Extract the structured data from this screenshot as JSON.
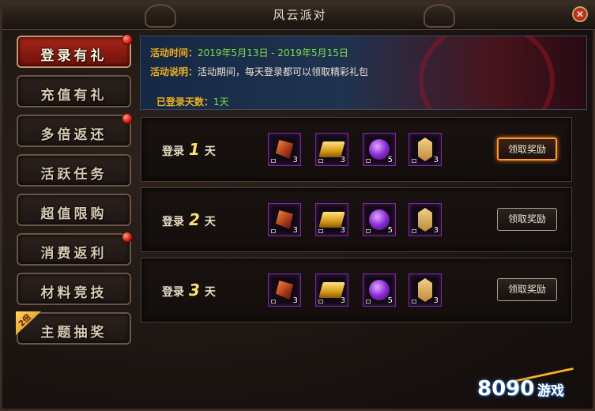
{
  "window": {
    "title": "风云派对"
  },
  "sidebar": {
    "items": [
      {
        "label": "登录有礼",
        "active": true,
        "has_dot": true
      },
      {
        "label": "充值有礼",
        "active": false,
        "has_dot": false
      },
      {
        "label": "多倍返还",
        "active": false,
        "has_dot": true
      },
      {
        "label": "活跃任务",
        "active": false,
        "has_dot": false
      },
      {
        "label": "超值限购",
        "active": false,
        "has_dot": false
      },
      {
        "label": "消费返利",
        "active": false,
        "has_dot": true
      },
      {
        "label": "材料竞技",
        "active": false,
        "has_dot": false
      },
      {
        "label": "主题抽奖",
        "active": false,
        "has_dot": false,
        "badge": "2倍"
      }
    ]
  },
  "banner": {
    "time_label": "活动时间：",
    "time_value": "2019年5月13日 - 2019年5月15日",
    "desc_label": "活动说明：",
    "desc_value": "活动期间，每天登录都可以领取精彩礼包",
    "days_label": "已登录天数：",
    "days_value": "1天"
  },
  "rows": [
    {
      "prefix": "登录",
      "day": "1",
      "suffix": "天",
      "button": "领取奖励",
      "highlighted": true,
      "items": [
        {
          "icon": "shard",
          "count": "3"
        },
        {
          "icon": "gold-bar",
          "count": "3"
        },
        {
          "icon": "purple-orb",
          "count": "5"
        },
        {
          "icon": "token",
          "count": "3"
        }
      ]
    },
    {
      "prefix": "登录",
      "day": "2",
      "suffix": "天",
      "button": "领取奖励",
      "highlighted": false,
      "items": [
        {
          "icon": "shard",
          "count": "3"
        },
        {
          "icon": "gold-bar",
          "count": "3"
        },
        {
          "icon": "purple-orb",
          "count": "5"
        },
        {
          "icon": "token",
          "count": "3"
        }
      ]
    },
    {
      "prefix": "登录",
      "day": "3",
      "suffix": "天",
      "button": "领取奖励",
      "highlighted": false,
      "items": [
        {
          "icon": "shard",
          "count": "3"
        },
        {
          "icon": "gold-bar",
          "count": "3"
        },
        {
          "icon": "purple-orb",
          "count": "5"
        },
        {
          "icon": "token",
          "count": "3"
        }
      ]
    }
  ],
  "watermark": {
    "number": "8090",
    "text": "游戏"
  },
  "colors": {
    "accent_red": "#a8251a",
    "label_gold": "#f0b020",
    "value_green": "#7ee04a",
    "item_border": "#7a2aa0"
  }
}
